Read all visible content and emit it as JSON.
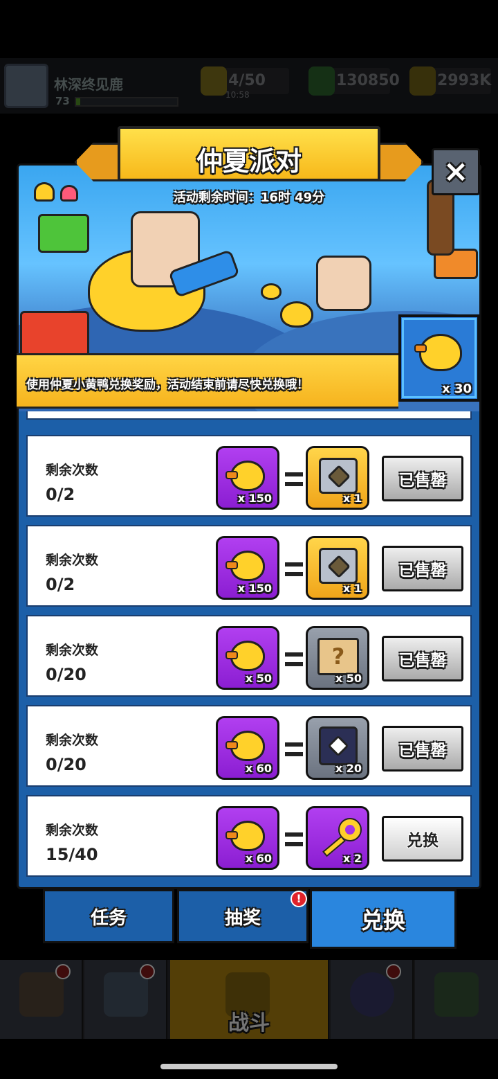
{
  "status_bar": {
    "player_name": "林深终见鹿",
    "player_level": "73",
    "xp_progress": 0.04,
    "energy": "4/50",
    "energy_timer": "10:58",
    "gems": "130850",
    "coins": "2993K"
  },
  "event": {
    "title": "仲夏派对",
    "countdown": "活动剩余时间：16时 49分",
    "info": "使用仲夏小黄鸭兑换奖励，活动结束前请尽快兑换哦！",
    "currency_count": "x 30",
    "close_icon": "×"
  },
  "exchange_rows": [
    {
      "label": "剩余次数",
      "count": "0/2",
      "cost": "x 150",
      "reward_icon": "gold-chest-icon",
      "reward_qty": "x 1",
      "action": "已售罄"
    },
    {
      "label": "剩余次数",
      "count": "0/2",
      "cost": "x 150",
      "reward_icon": "gold-chest-shield-icon",
      "reward_qty": "x 1",
      "action": "已售罄"
    },
    {
      "label": "剩余次数",
      "count": "0/20",
      "cost": "x 50",
      "reward_icon": "mystery-scroll-icon",
      "reward_qty": "x 50",
      "action": "已售罄"
    },
    {
      "label": "剩余次数",
      "count": "0/20",
      "cost": "x 60",
      "reward_icon": "tech-box-icon",
      "reward_qty": "x 20",
      "action": "已售罄"
    },
    {
      "label": "剩余次数",
      "count": "15/40",
      "cost": "x 60",
      "reward_icon": "key-icon",
      "reward_qty": "x 2",
      "action": "兑换"
    }
  ],
  "tabs": {
    "tasks": "任务",
    "lottery": "抽奖",
    "exchange": "兑换",
    "lottery_alert": "!"
  },
  "bottom_nav": {
    "battle": "战斗"
  }
}
